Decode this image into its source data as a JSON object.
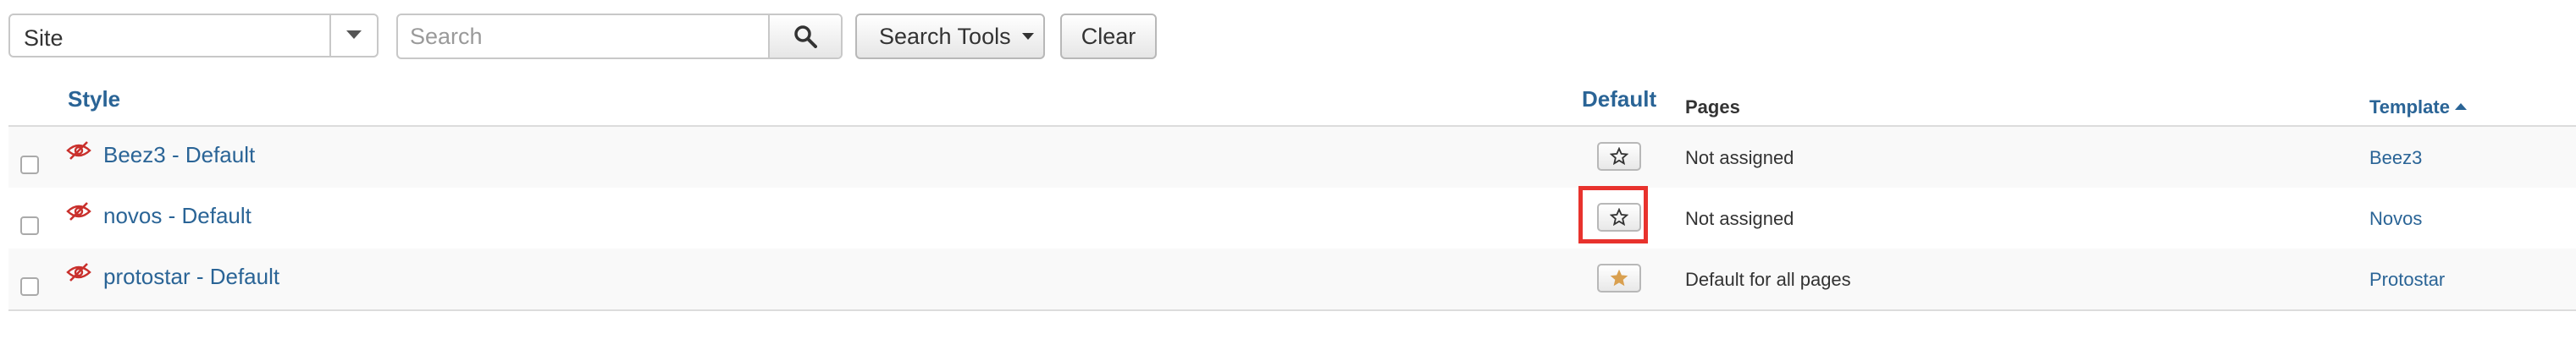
{
  "filters": {
    "client_select": "Site",
    "search_placeholder": "Search",
    "search_tools_label": "Search Tools",
    "clear_label": "Clear"
  },
  "table": {
    "columns": {
      "style": "Style",
      "default": "Default",
      "pages": "Pages",
      "template": "Template"
    },
    "rows": [
      {
        "style": "Beez3 - Default",
        "default_icon": "star-empty-icon",
        "pages": "Not assigned",
        "template": "Beez3"
      },
      {
        "style": "novos - Default",
        "default_icon": "star-empty-icon",
        "pages": "Not assigned",
        "template": "Novos"
      },
      {
        "style": "protostar - Default",
        "default_icon": "star-filled-icon",
        "pages": "Default for all pages",
        "template": "Protostar"
      }
    ]
  },
  "colors": {
    "link": "#2a6496",
    "default_star": "#d9a050",
    "highlight": "#e8322d",
    "eye_slash": "#c9302c"
  }
}
